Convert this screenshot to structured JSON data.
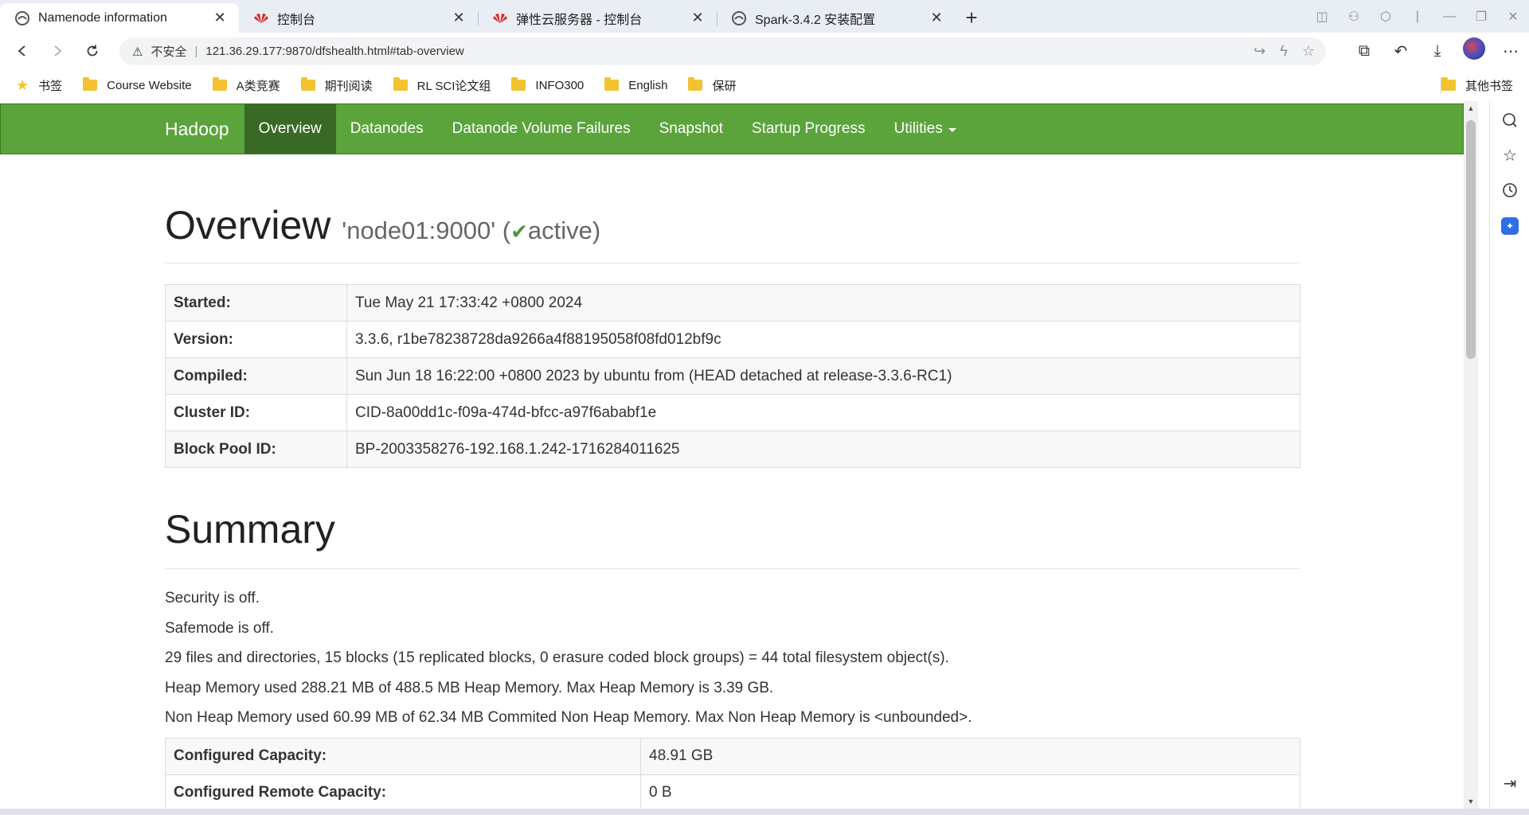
{
  "browser": {
    "tabs": [
      {
        "title": "Namenode information",
        "icon": "edge-tab-icon",
        "active": true
      },
      {
        "title": "控制台",
        "icon": "huawei-icon",
        "active": false
      },
      {
        "title": "弹性云服务器 - 控制台",
        "icon": "huawei-icon",
        "active": false
      },
      {
        "title": "Spark-3.4.2 安装配置",
        "icon": "edge-tab-icon",
        "active": false
      }
    ],
    "address": {
      "insecure_label": "不安全",
      "separator": "|",
      "url": "121.36.29.177:9870/dfshealth.html#tab-overview"
    },
    "bookmarks": [
      {
        "label": "书签",
        "icon": "star-icon"
      },
      {
        "label": "Course Website",
        "icon": "folder-icon"
      },
      {
        "label": "A类竞赛",
        "icon": "folder-icon"
      },
      {
        "label": "期刊阅读",
        "icon": "folder-icon"
      },
      {
        "label": "RL SCI论文组",
        "icon": "folder-icon"
      },
      {
        "label": "INFO300",
        "icon": "folder-icon"
      },
      {
        "label": "English",
        "icon": "folder-icon"
      },
      {
        "label": "保研",
        "icon": "folder-icon"
      }
    ],
    "other_bookmarks": "其他书签"
  },
  "navbar": {
    "brand": "Hadoop",
    "items": [
      "Overview",
      "Datanodes",
      "Datanode Volume Failures",
      "Snapshot",
      "Startup Progress",
      "Utilities"
    ],
    "active_index": 0,
    "bg_color": "#5ba33b"
  },
  "overview": {
    "title": "Overview",
    "node": "'node01:9000'",
    "status_open": "(",
    "status": "active",
    "status_close": ")",
    "rows": [
      {
        "key": "Started:",
        "value": "Tue May 21 17:33:42 +0800 2024"
      },
      {
        "key": "Version:",
        "value": "3.3.6, r1be78238728da9266a4f88195058f08fd012bf9c"
      },
      {
        "key": "Compiled:",
        "value": "Sun Jun 18 16:22:00 +0800 2023 by ubuntu from (HEAD detached at release-3.3.6-RC1)"
      },
      {
        "key": "Cluster ID:",
        "value": "CID-8a00dd1c-f09a-474d-bfcc-a97f6ababf1e"
      },
      {
        "key": "Block Pool ID:",
        "value": "BP-2003358276-192.168.1.242-1716284011625"
      }
    ]
  },
  "summary": {
    "title": "Summary",
    "lines": [
      "Security is off.",
      "Safemode is off.",
      "29 files and directories, 15 blocks (15 replicated blocks, 0 erasure coded block groups) = 44 total filesystem object(s).",
      "Heap Memory used 288.21 MB of 488.5 MB Heap Memory. Max Heap Memory is 3.39 GB.",
      "Non Heap Memory used 60.99 MB of 62.34 MB Commited Non Heap Memory. Max Non Heap Memory is <unbounded>."
    ],
    "rows": [
      {
        "key": "Configured Capacity:",
        "value": "48.91 GB"
      },
      {
        "key": "Configured Remote Capacity:",
        "value": "0 B"
      }
    ]
  }
}
